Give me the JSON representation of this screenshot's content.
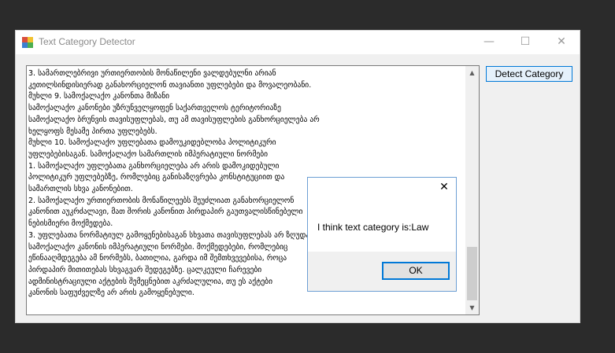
{
  "window": {
    "title": "Text Category Detector",
    "minimize_glyph": "—",
    "maximize_glyph": "☐",
    "close_glyph": "✕"
  },
  "textbox": {
    "lines": [
      "3. სამართლებრივი ურთიერთობის მონაწილენი ვალდებულნი არიან",
      "კეთილსინდისიერად განახორციელონ თავიანთი უფლებები და მოვალეობანი.",
      "მუხლი 9. სამოქალაქო კანონთა მიზანი",
      "სამოქალაქო კანონები უზრუნველყოფენ საქართველოს ტერიტორიაზე",
      "სამოქალაქო ბრუნვის თავისუფლებას, თუ ამ თავისუფლების განხორციელება არ",
      "ხელყოფს მესამე პირთა უფლებებს.",
      "მუხლი 10. სამოქალაქო უფლებათა დამოუკიდებლობა პოლიტიკური",
      " უფლებებისაგან. სამოქალაქო სამართლის იმპერატიული ნორმები",
      "1. სამოქალაქო უფლებათა განხორციელება არ არის დამოკიდებული",
      "პოლიტიკურ უფლებებზე, რომლებიც განისაზღვრება კონსტიტუციით და",
      "სამართლის სხვა კანონებით.",
      "2. სამოქალაქო ურთიერთობის მონაწილეებს შეუძლიათ განახორციელონ",
      "კანონით აუკრძალავი, მათ შორის კანონით პირდაპირ გაუთვალისწინებელი",
      "ნებისმიერი მოქმედება.",
      "3. უფლებათა ნორმატიულ გამოყენებისაგან სხვათა თავისუფლებას არ ზღუდავს",
      "სამოქალაქო კანონის იმპერატიული ნორმები. მოქმედებები, რომლებიც",
      "ეწინააღმდეგება ამ ნორმებს, ბათილია, გარდა იმ შემთხვევებისა, როცა",
      "პირდაპირ მითითებას სხვაგვარ შედეგებზე. ცალკეული ჩარევები",
      "ადმინისტრაციული აქტების შემეცნებით აკრძალულია, თუ ეს აქტები",
      "კანონის საფუძველზე არ არის გამოყენებული."
    ]
  },
  "detect_button": {
    "label": "Detect Category"
  },
  "dialog": {
    "message": "I think text category is:Law",
    "ok_label": "OK",
    "close_glyph": "✕"
  }
}
